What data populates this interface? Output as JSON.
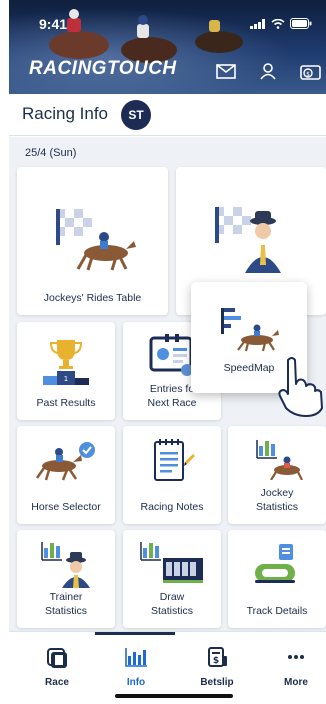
{
  "status": {
    "time": "9:41"
  },
  "header": {
    "logo": "RACINGTOUCH",
    "icons": [
      "mail-icon",
      "user-icon",
      "wallet-icon"
    ]
  },
  "info_bar": {
    "title": "Racing Info",
    "badge": "ST"
  },
  "date": "25/4 (Sun)",
  "tiles": {
    "jockeys_rides": "Jockeys' Rides Table",
    "speedmap": "SpeedMap",
    "past_results": "Past Results",
    "entries_line1": "Entries fo",
    "entries_line2": "Next Race",
    "horse_selector": "Horse Selector",
    "racing_notes": "Racing Notes",
    "jockey_stats_line1": "Jockey",
    "jockey_stats_line2": "Statistics",
    "trainer_stats_line1": "Trainer",
    "trainer_stats_line2": "Statistics",
    "draw_stats_line1": "Draw",
    "draw_stats_line2": "Statistics",
    "track_details": "Track Details"
  },
  "tabbar": {
    "items": [
      {
        "label": "Race",
        "icon": "race-icon"
      },
      {
        "label": "Info",
        "icon": "info-chart-icon"
      },
      {
        "label": "Betslip",
        "icon": "betslip-icon"
      },
      {
        "label": "More",
        "icon": "more-icon"
      }
    ],
    "active": "Info"
  },
  "colors": {
    "navy": "#1d2c55",
    "accent_blue": "#1d6bd6",
    "bg": "#eef1f6"
  }
}
